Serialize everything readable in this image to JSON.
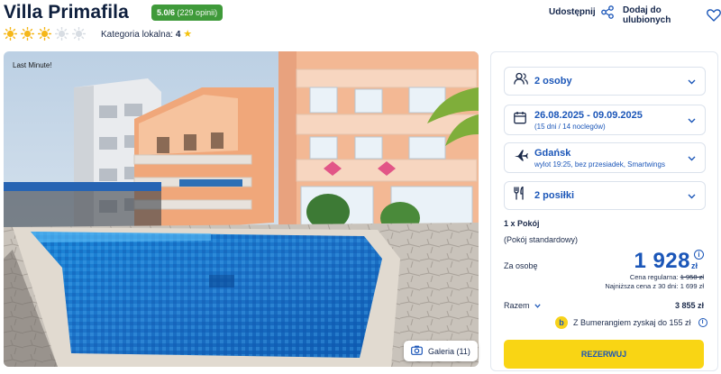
{
  "header": {
    "title": "Villa Primafila",
    "rating_score": "5.0/6",
    "rating_count": "(229 opinii)",
    "suns_filled": 3,
    "suns_total": 5,
    "category_label": "Kategoria lokalna:",
    "category_value": "4",
    "share_label": "Udostępnij",
    "favorite_label": "Dodaj do ulubionych"
  },
  "photo": {
    "badge": "Last Minute!",
    "gallery_label": "Galeria (11)"
  },
  "booking": {
    "guests": {
      "icon": "people-icon",
      "label": "2 osoby"
    },
    "dates": {
      "icon": "calendar-icon",
      "label": "26.08.2025 - 09.09.2025",
      "sub": "(15 dni / 14 noclegów)"
    },
    "flight": {
      "icon": "plane-icon",
      "label": "Gdańsk",
      "sub": "wylot 19:25, bez przesiadek, Smartwings"
    },
    "meals": {
      "icon": "cutlery-icon",
      "label": "2 posiłki"
    },
    "room_count": "1 x Pokój",
    "room_type": "(Pokój standardowy)",
    "per_person_label": "Za osobę",
    "price": "1 928",
    "currency": "zł",
    "regular_label": "Cena regularna:",
    "regular_price": "1 958 zł",
    "lowest_label": "Najniższa cena z 30 dni:",
    "lowest_price": "1 699 zł",
    "total_label": "Razem",
    "total_value": "3 855 zł",
    "bumerang_text": "Z Bumerangiem zyskaj do 155 zł",
    "reserve_label": "REZERWUJ"
  },
  "colors": {
    "accent": "#1b56b8",
    "rating_green": "#3f9a3a",
    "cta_yellow": "#f9d514",
    "sun_filled": "#f5b71a",
    "sun_empty": "#d8dde3"
  }
}
